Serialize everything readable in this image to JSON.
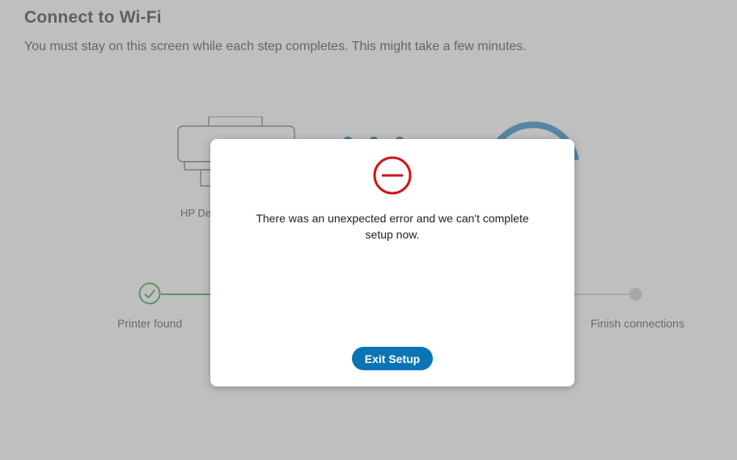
{
  "header": {
    "title": "Connect to Wi-Fi",
    "subtitle": "You must stay on this screen while each step completes. This might take a few minutes."
  },
  "illustration": {
    "printer_label": "HP De",
    "printer_icon": "printer-icon",
    "router_icon": "wifi-router-icon",
    "progress_dots_icon": "progress-dots-icon"
  },
  "steps": {
    "first_label": "Printer found",
    "last_label": "Finish connections",
    "check_icon": "check-circle-icon",
    "pending_icon": "pending-dot-icon"
  },
  "dialog": {
    "icon": "error-no-entry-icon",
    "message": "There was an unexpected error and we can't complete setup now.",
    "exit_label": "Exit Setup"
  },
  "colors": {
    "accent": "#0b74b5",
    "error": "#d0141b",
    "success": "#3fa34d",
    "overlay": "rgba(128,128,128,0.5)"
  }
}
